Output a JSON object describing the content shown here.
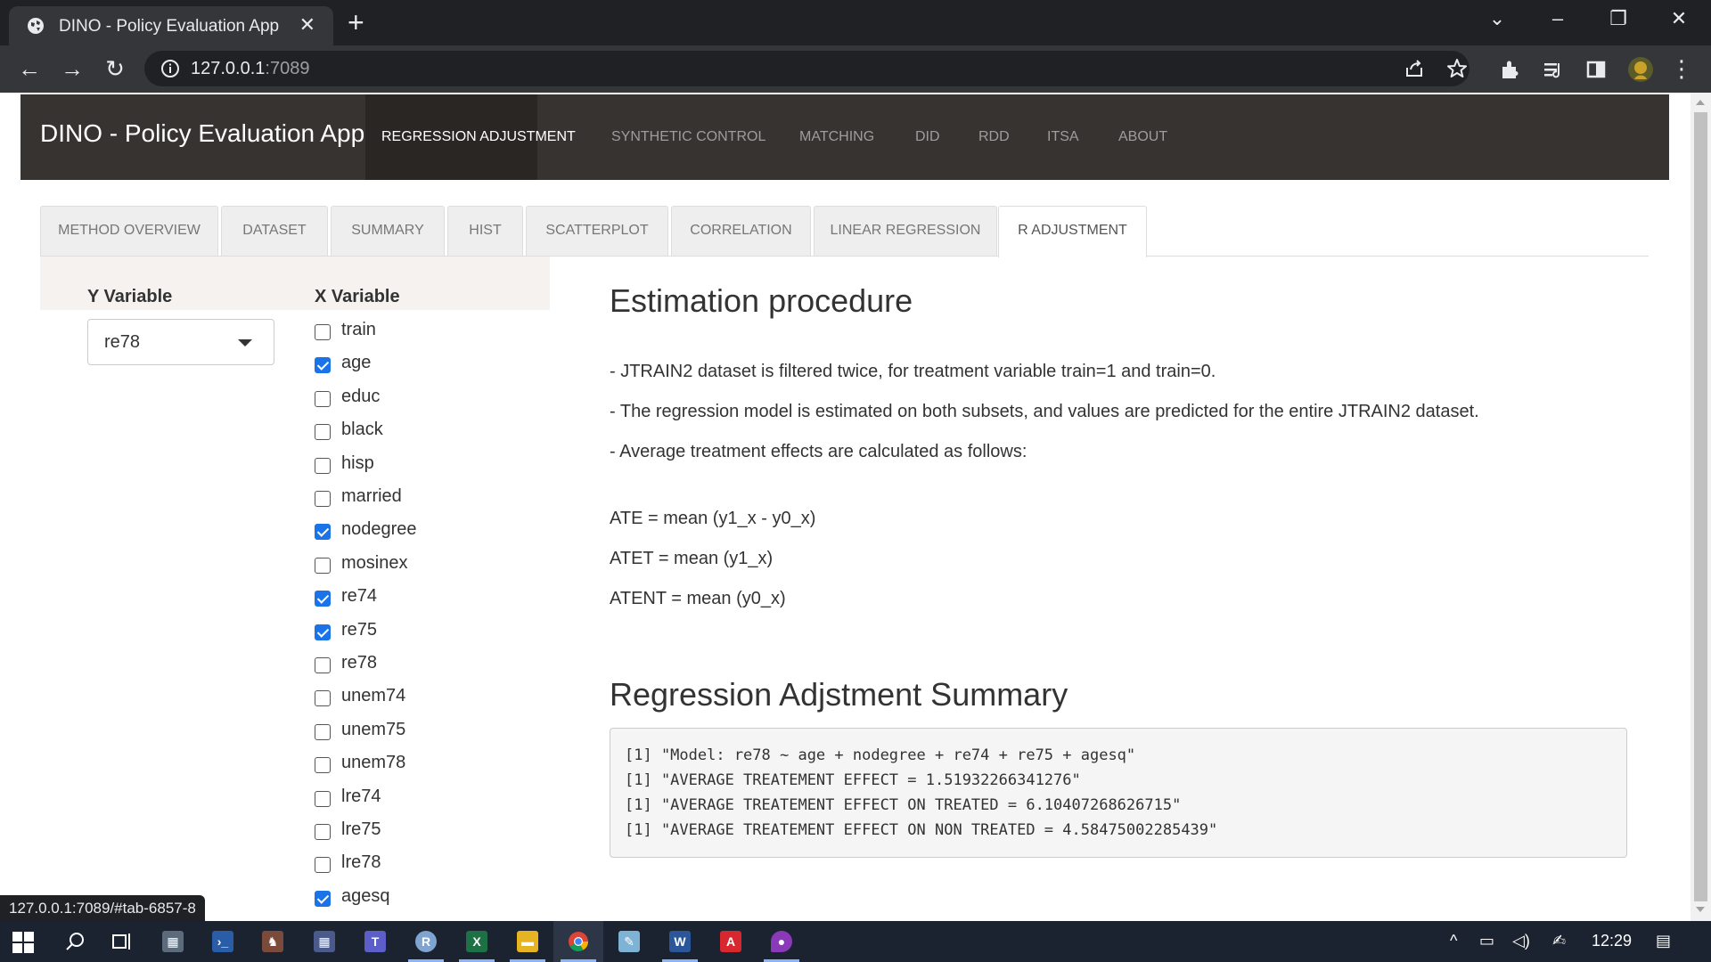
{
  "browser": {
    "tab_title": "DINO - Policy Evaluation App",
    "url_host": "127.0.0.1",
    "url_port": ":7089",
    "status_url": "127.0.0.1:7089/#tab-6857-8"
  },
  "app": {
    "brand": "DINO - Policy Evaluation App",
    "nav": [
      "REGRESSION ADJUSTMENT",
      "SYNTHETIC CONTROL",
      "MATCHING",
      "DID",
      "RDD",
      "ITSA",
      "ABOUT"
    ],
    "active_nav": "REGRESSION ADJUSTMENT"
  },
  "subtabs": [
    "METHOD OVERVIEW",
    "DATASET",
    "SUMMARY",
    "HIST",
    "SCATTERPLOT",
    "CORRELATION",
    "LINEAR REGRESSION",
    "R ADJUSTMENT"
  ],
  "active_subtab": "R ADJUSTMENT",
  "sidebar": {
    "y_label": "Y Variable",
    "y_value": "re78",
    "x_label": "X Variable",
    "x_vars": [
      {
        "name": "train",
        "checked": false
      },
      {
        "name": "age",
        "checked": true
      },
      {
        "name": "educ",
        "checked": false
      },
      {
        "name": "black",
        "checked": false
      },
      {
        "name": "hisp",
        "checked": false
      },
      {
        "name": "married",
        "checked": false
      },
      {
        "name": "nodegree",
        "checked": true
      },
      {
        "name": "mosinex",
        "checked": false
      },
      {
        "name": "re74",
        "checked": true
      },
      {
        "name": "re75",
        "checked": true
      },
      {
        "name": "re78",
        "checked": false
      },
      {
        "name": "unem74",
        "checked": false
      },
      {
        "name": "unem75",
        "checked": false
      },
      {
        "name": "unem78",
        "checked": false
      },
      {
        "name": "lre74",
        "checked": false
      },
      {
        "name": "lre75",
        "checked": false
      },
      {
        "name": "lre78",
        "checked": false
      },
      {
        "name": "agesq",
        "checked": true
      }
    ]
  },
  "main": {
    "heading1": "Estimation procedure",
    "p1": "- JTRAIN2 dataset is filtered twice, for treatment variable train=1 and train=0.",
    "p2": "- The regression model is estimated on both subsets, and values are predicted for the entire JTRAIN2 dataset.",
    "p3": "- Average treatment effects are calculated as follows:",
    "ate": "ATE = mean (y1_x - y0_x)",
    "atet": "ATET = mean (y1_x)",
    "atent": "ATENT = mean (y0_x)",
    "heading2": "Regression Adjstment Summary",
    "output": [
      "[1] \"Model: re78 ~ age + nodegree + re74 + re75 + agesq\"",
      "[1] \"AVERAGE TREATEMENT EFFECT = 1.51932266341276\"",
      "[1] \"AVERAGE TREATEMENT EFFECT ON TREATED = 6.10407268626715\"",
      "[1] \"AVERAGE TREATEMENT EFFECT ON NON TREATED = 4.58475002285439\""
    ]
  },
  "taskbar": {
    "clock": "12:29",
    "apps": [
      "windows-start",
      "search",
      "task-view",
      "calculator",
      "powershell",
      "media",
      "grid-app",
      "teams",
      "r",
      "excel",
      "file-explorer",
      "chrome",
      "notepad",
      "word",
      "acrobat",
      "paint"
    ]
  },
  "colors": {
    "navbar": "#373330",
    "checkbox_checked": "#1a73e8",
    "taskbar": "#1b2330"
  }
}
